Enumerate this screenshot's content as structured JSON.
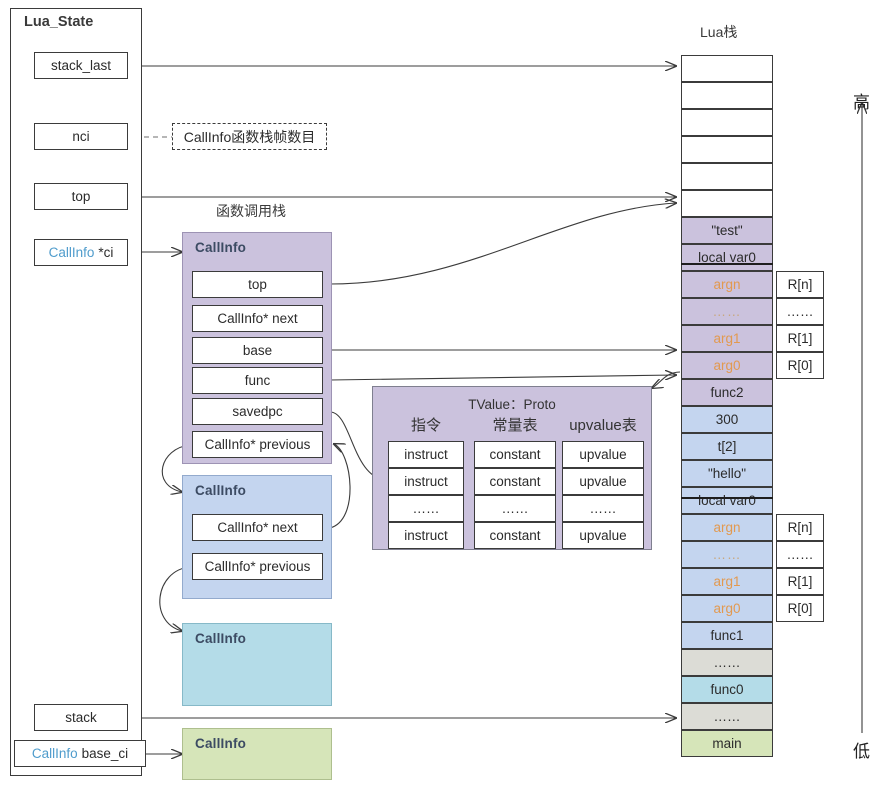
{
  "diagram": {
    "title_lua_state": "Lua_State",
    "title_call_stack": "函数调用栈",
    "title_lua_stack": "Lua栈",
    "note_nci": "CallInfo函数栈帧数目",
    "note_nci_kw": "CallInfo",
    "note_nci_rest": "函数栈帧数目",
    "axis_high": "高",
    "axis_low": "低"
  },
  "lua_state": {
    "fields": [
      {
        "label": "stack_last",
        "kw": ""
      },
      {
        "label": "nci",
        "kw": ""
      },
      {
        "label": "top",
        "kw": ""
      },
      {
        "label": "*ci",
        "kw": "CallInfo"
      },
      {
        "label": "stack",
        "kw": ""
      },
      {
        "label": "base_ci",
        "kw": "CallInfo"
      }
    ]
  },
  "callinfos": [
    {
      "head": "CallInfo",
      "color": "purple",
      "fields": [
        "top",
        "CallInfo* next",
        "base",
        "func",
        "savedpc",
        "CallInfo* previous"
      ]
    },
    {
      "head": "CallInfo",
      "color": "blue",
      "fields": [
        "CallInfo* next",
        "CallInfo* previous"
      ]
    },
    {
      "head": "CallInfo",
      "color": "teal",
      "fields": []
    },
    {
      "head": "CallInfo",
      "color": "green",
      "fields": []
    }
  ],
  "proto": {
    "title": "TValue：Proto",
    "columns": [
      {
        "header": "指令",
        "cells": [
          "instruct",
          "instruct",
          "……",
          "instruct"
        ]
      },
      {
        "header": "常量表",
        "cells": [
          "constant",
          "constant",
          "……",
          "constant"
        ]
      },
      {
        "header": "upvalue表",
        "cells": [
          "upvalue",
          "upvalue",
          "……",
          "upvalue"
        ]
      }
    ]
  },
  "lua_stack": {
    "cells": [
      {
        "text": "",
        "style": "empty"
      },
      {
        "text": "",
        "style": "empty"
      },
      {
        "text": "",
        "style": "empty"
      },
      {
        "text": "",
        "style": "empty"
      },
      {
        "text": "",
        "style": "empty"
      },
      {
        "text": "",
        "style": "empty"
      },
      {
        "text": "\"test\"",
        "style": "p"
      },
      {
        "text": "local var0",
        "style": "p"
      },
      {
        "text": "argn",
        "style": "p arg",
        "reg": "R[n]"
      },
      {
        "text": "……",
        "style": "p dots",
        "reg": "……"
      },
      {
        "text": "arg1",
        "style": "p arg",
        "reg": "R[1]"
      },
      {
        "text": "arg0",
        "style": "p arg",
        "reg": "R[0]"
      },
      {
        "text": "func2",
        "style": "p"
      },
      {
        "text": "300",
        "style": "b"
      },
      {
        "text": "t[2]",
        "style": "b"
      },
      {
        "text": "\"hello\"",
        "style": "b"
      },
      {
        "text": "local var0",
        "style": "b"
      },
      {
        "text": "argn",
        "style": "b arg",
        "reg": "R[n]"
      },
      {
        "text": "……",
        "style": "b dots",
        "reg": "……"
      },
      {
        "text": "arg1",
        "style": "b arg",
        "reg": "R[1]"
      },
      {
        "text": "arg0",
        "style": "b arg",
        "reg": "R[0]"
      },
      {
        "text": "func1",
        "style": "b"
      },
      {
        "text": "……",
        "style": "g"
      },
      {
        "text": "func0",
        "style": "t"
      },
      {
        "text": "……",
        "style": "g"
      },
      {
        "text": "main",
        "style": "m"
      }
    ]
  },
  "colors": {
    "purple": "#cbc2dd",
    "blue": "#c4d5ef",
    "teal": "#b4dce8",
    "green": "#d6e5b9",
    "gray": "#dcdcd6",
    "keyword": "#4f9ccc",
    "arg": "#e2994f",
    "stroke": "#3b3b3b"
  }
}
